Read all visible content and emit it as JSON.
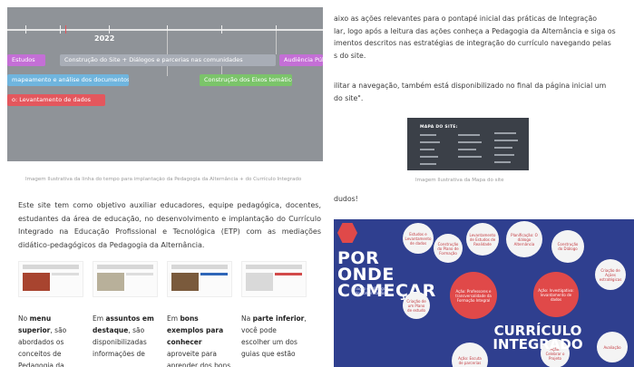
{
  "timeline": {
    "year": "2022",
    "bars": [
      {
        "label": "Estudos",
        "color": "#c46fd6"
      },
      {
        "label": "Construção do Site + Diálogos e parcerias nas comunidades",
        "color": "#a8adb6"
      },
      {
        "label": "Audiência Pública",
        "color": "#c46fd6"
      },
      {
        "label": "mapeamento e análise dos documentos",
        "color": "#6fb5de"
      },
      {
        "label": "Construção dos Eixos temáticos",
        "color": "#7bc46a"
      },
      {
        "label": "o: Levantamento de dados",
        "color": "#e4575d"
      }
    ],
    "caption": "Imagem Ilustrativa da linha do tempo para implantação da Pedagogia da Alternância + do Currículo Integrado"
  },
  "intro": {
    "text": "Este site tem como objetivo auxiliar educadores, equipe pedagógica, docentes, estudantes da área de educação, no desenvolvimento e implantação do Currículo Integrado na Educação Profissional e Tecnológica (ETP) com as mediações didático-pedagógicos da Pedagogia da Alternância."
  },
  "thumbs": [
    {
      "label": "menu"
    },
    {
      "label": "Assuntos em destaque"
    },
    {
      "label": "Bons exemplos para conhecer"
    },
    {
      "label": "parte inferior"
    }
  ],
  "columns": [
    {
      "pre": "No ",
      "bold": "menu superior",
      "post": ", são abordados os conceitos de Pedagogia da"
    },
    {
      "pre": "Em ",
      "bold": "assuntos em destaque",
      "post": ", são disponibilizadas informações de"
    },
    {
      "pre": "Em ",
      "bold": "bons exemplos para conhecer",
      "post": " aproveite para aprender dos bons"
    },
    {
      "pre": "Na ",
      "bold": "parte inferior",
      "post": ", você pode escolher um dos guias que estão"
    }
  ],
  "right": {
    "lines": [
      "aixo as ações relevantes para o pontapé inicial das práticas de Integração",
      "lar, logo após a leitura das ações conheça a Pedagogia da Alternância e siga os",
      "imentos descritos nas estratégias de integração do currículo navegando pelas",
      "s do site."
    ],
    "lines2": [
      "ilitar a navegação, também está disponibilizado no final da página inicial um",
      "do site\"."
    ],
    "map_title": "MAPA DO SITE:",
    "map_caption": "Imagem Ilustrativa da Mapa do site",
    "partial": "dudos!"
  },
  "poster": {
    "title_lines": [
      "POR",
      "ONDE",
      "COMEÇAR"
    ],
    "curriculo": "CURRÍCULO INTEGRADO",
    "note": "Criação de diálogo e de comunicação",
    "bubbles": [
      "Estudos e Levantamento de dados",
      "Construção do Plano de Formação",
      "Levantamento de Estudos de Realidade",
      "Planificação: O diálogo Alternância",
      "Construção do Diálogo",
      "Ação: Professores e transversalidade da Formação Integral",
      "Ação: Investigativa: levantamento de dados",
      "Criação de um Plano de estudo",
      "Criação de Ações estratégicas",
      "Ação: Celebrar o Projeto",
      "Ação: Escuta de parcerias",
      "Avaliação"
    ]
  }
}
